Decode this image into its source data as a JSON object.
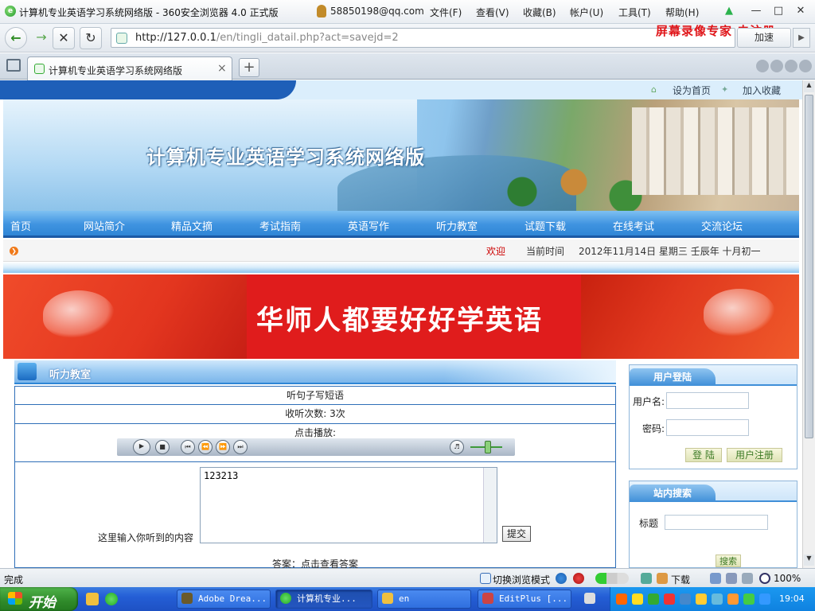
{
  "browser": {
    "window_title": "计算机专业英语学习系统网络版 - 360安全浏览器 4.0 正式版",
    "account": "58850198@qq.com",
    "menu": [
      "文件(F)",
      "查看(V)",
      "收藏(B)",
      "帐户(U)",
      "工具(T)",
      "帮助(H)"
    ],
    "url_host": "http://127.0.0.1",
    "url_path": "/en/tingli_datail.php?act=savejd=2",
    "watermark": "屏幕录像专家  未注册",
    "add_btn": "加速",
    "tab_title": "计算机专业英语学习系统网络版",
    "new_tab": "+",
    "close_tab": "×"
  },
  "site": {
    "toplinks": [
      "设为首页",
      "加入收藏"
    ],
    "title": "计算机专业英语学习系统网络版",
    "nav": [
      "首页",
      "网站简介",
      "精品文摘",
      "考试指南",
      "英语写作",
      "听力教室",
      "试题下载",
      "在线考试",
      "交流论坛"
    ],
    "welcome": "欢迎",
    "current_time_label": "当前时间",
    "date_text": "2012年11月14日  星期三  壬辰年  十月初一",
    "slogan": "华师人都要好好学英语"
  },
  "listening": {
    "panel_title": "听力教室",
    "exercise_title": "听句子写短语",
    "listen_count": "收听次数: 3次",
    "play_label": "点击播放:",
    "answer_value": "123213",
    "input_label": "这里输入你听到的内容",
    "submit": "提交",
    "answer_link": "答案：点击查看答案"
  },
  "login": {
    "title": "用户登陆",
    "username_label": "用户名:",
    "password_label": "密码:",
    "login_btn": "登 陆",
    "register_btn": "用户注册"
  },
  "search": {
    "title": "站内搜索",
    "keyword_label": "标题",
    "search_btn": "搜索"
  },
  "statusbar": {
    "status": "完成",
    "mode": "切换浏览模式",
    "download": "下载",
    "zoom": "100%"
  },
  "taskbar": {
    "start": "开始",
    "tasks": [
      "Adobe Drea...",
      "计算机专业...",
      "en",
      "EditPlus [..."
    ],
    "clock": "19:04"
  }
}
